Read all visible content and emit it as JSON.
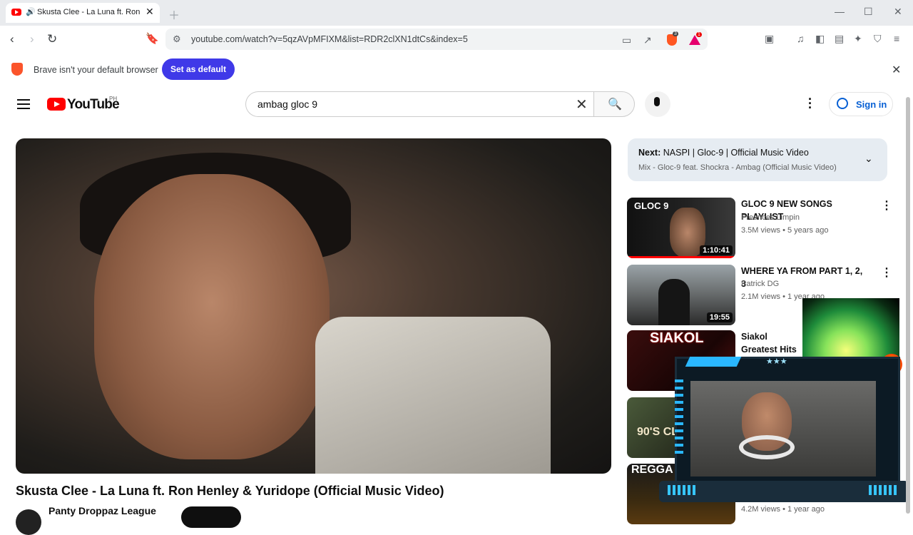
{
  "browser": {
    "tab_title": "Skusta Clee - La Luna ft. Ron Henley & Yuridope (Official Music Video)",
    "url": "youtube.com/watch?v=5qzAVpMFIXM&list=RDR2clXN1dtCs&index=5",
    "shield_badge": "3",
    "rewards_badge": "1",
    "infobar_text": "Brave isn't your default browser",
    "set_default_label": "Set as default"
  },
  "youtube": {
    "logo_text": "YouTube",
    "region": "PH",
    "search_value": "ambag gloc 9",
    "signin_label": "Sign in"
  },
  "video": {
    "title": "Skusta Clee - La Luna ft. Ron Henley & Yuridope (Official Music Video)",
    "channel": "Panty Droppaz League"
  },
  "playlist_next": {
    "label": "Next:",
    "title": "NASPI | Gloc-9 | Official Music Video",
    "mix": "Mix - Gloc-9 feat. Shockra - Ambag (Official Music Video)"
  },
  "recommendations": [
    {
      "title": "GLOC 9 NEW SONGS PLAYLIST",
      "channel": "Preances Limpin",
      "meta": "3.5M views • 5 years ago",
      "duration": "1:10:41",
      "thumb_text": "GLOC 9"
    },
    {
      "title": "WHERE YA FROM PART 1, 2, 3",
      "channel": "Patrick DG",
      "meta": "2.1M views • 1 year ago",
      "duration": "19:55"
    },
    {
      "title": "Siakol Greatest Hits Very Best OPM",
      "thumb_text": "SIAKOL"
    },
    {
      "thumb_text": "90'S CL"
    },
    {
      "meta": "4.2M views • 1 year ago",
      "thumb_text": "REGGA"
    }
  ],
  "overlay": {
    "stars": "★★★"
  },
  "colors": {
    "brand_red": "#ff0000",
    "brave_primary": "#3f39e8",
    "link_blue": "#065fd4"
  }
}
